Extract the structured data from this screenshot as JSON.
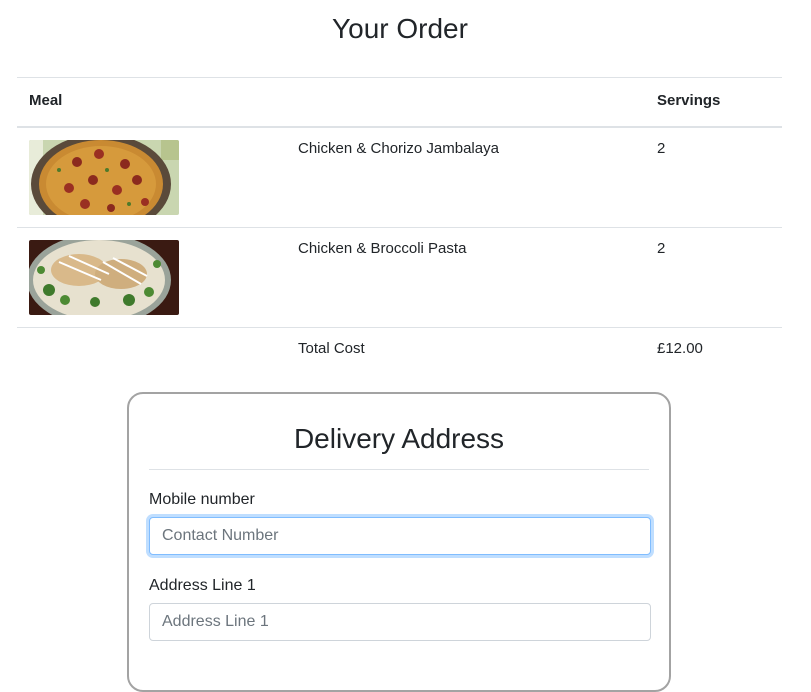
{
  "order": {
    "title": "Your Order",
    "columns": {
      "meal": "Meal",
      "name": "",
      "servings": "Servings"
    },
    "items": [
      {
        "name": "Chicken & Chorizo Jambalaya",
        "servings": "2",
        "image": "jambalaya-image"
      },
      {
        "name": "Chicken & Broccoli Pasta",
        "servings": "2",
        "image": "pasta-image"
      }
    ],
    "total_label": "Total Cost",
    "total_value": "£12.00"
  },
  "delivery": {
    "title": "Delivery Address",
    "fields": [
      {
        "label": "Mobile number",
        "placeholder": "Contact Number",
        "value": ""
      },
      {
        "label": "Address Line 1",
        "placeholder": "Address Line 1",
        "value": ""
      }
    ]
  },
  "colors": {
    "card_border": "#a3a3a3",
    "focus_border": "#80bdff",
    "table_border": "#dee2e6"
  }
}
